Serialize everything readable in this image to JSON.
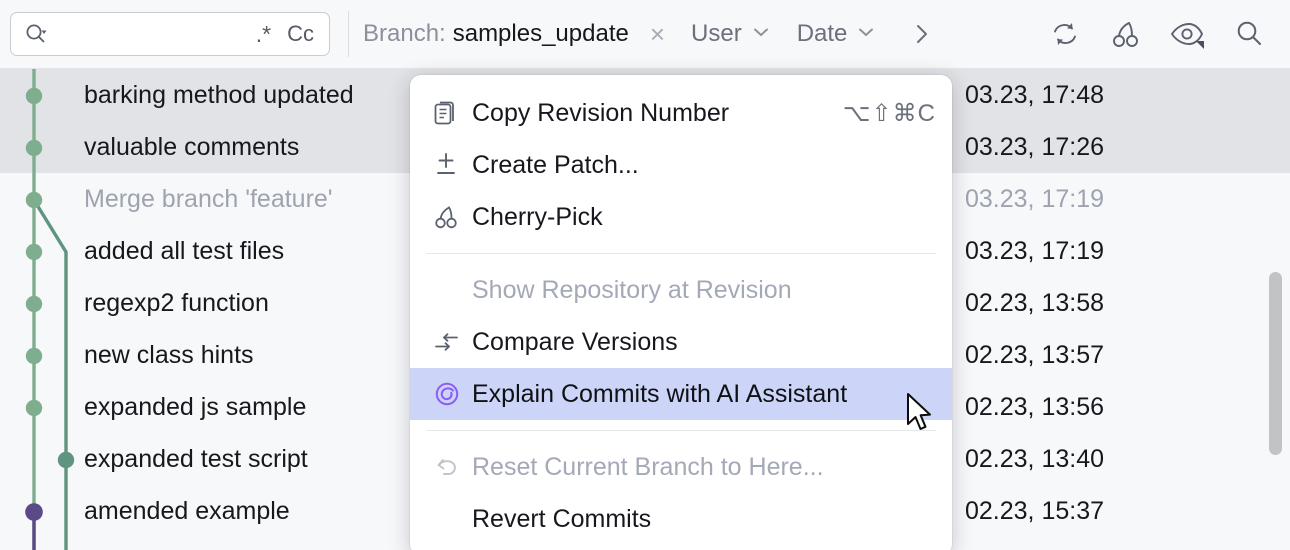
{
  "toolbar": {
    "search": {
      "value": "",
      "placeholder": "",
      "icon": "search-dropdown-icon"
    },
    "regex_toggle": ".*",
    "case_toggle": "Cc",
    "branch_filter": {
      "key": "Branch:",
      "value": "samples_update",
      "clear": "×"
    },
    "user_filter": "User",
    "date_filter": "Date",
    "more_chevron": "›",
    "actions": [
      {
        "name": "refresh-icon",
        "label": "Refresh"
      },
      {
        "name": "cherry-pick-icon",
        "label": "Cherry-Pick"
      },
      {
        "name": "eye-icon",
        "label": "Show Details"
      },
      {
        "name": "search-icon",
        "label": "Search"
      }
    ]
  },
  "log": {
    "rows": [
      {
        "subject": "barking method updated",
        "date": "03.23, 17:48",
        "selected": true,
        "muted": false
      },
      {
        "subject": "valuable comments",
        "date": "03.23, 17:26",
        "selected": true,
        "muted": false
      },
      {
        "subject": "Merge branch 'feature'",
        "date": "03.23, 17:19",
        "selected": false,
        "muted": true
      },
      {
        "subject": "added all test files",
        "date": "03.23, 17:19",
        "selected": false,
        "muted": false
      },
      {
        "subject": "regexp2 function",
        "date": "02.23, 13:58",
        "selected": false,
        "muted": false
      },
      {
        "subject": "new class hints",
        "date": "02.23, 13:57",
        "selected": false,
        "muted": false
      },
      {
        "subject": "expanded js sample",
        "date": "02.23, 13:56",
        "selected": false,
        "muted": false
      },
      {
        "subject": "expanded test script",
        "date": "02.23, 13:40",
        "selected": false,
        "muted": false
      },
      {
        "subject": "amended example",
        "date": "02.23, 15:37",
        "selected": false,
        "muted": false
      }
    ],
    "graph_colors": {
      "lane_main": "#7fae8e",
      "lane_branch": "#5f9480",
      "node_head": "#5a4a87"
    }
  },
  "context_menu": {
    "items": [
      {
        "label": "Copy Revision Number",
        "icon": "copy-icon",
        "shortcut": "⌥⇧⌘C",
        "disabled": false,
        "highlight": false,
        "sep_after": false
      },
      {
        "label": "Create Patch...",
        "icon": "patch-icon",
        "shortcut": "",
        "disabled": false,
        "highlight": false,
        "sep_after": false
      },
      {
        "label": "Cherry-Pick",
        "icon": "cherry-icon",
        "shortcut": "",
        "disabled": false,
        "highlight": false,
        "sep_after": true
      },
      {
        "label": "Show Repository at Revision",
        "icon": "none",
        "shortcut": "",
        "disabled": true,
        "highlight": false,
        "sep_after": false
      },
      {
        "label": "Compare Versions",
        "icon": "compare-icon",
        "shortcut": "",
        "disabled": false,
        "highlight": false,
        "sep_after": false
      },
      {
        "label": "Explain Commits with AI Assistant",
        "icon": "ai-assistant-icon",
        "shortcut": "",
        "disabled": false,
        "highlight": true,
        "sep_after": true
      },
      {
        "label": "Reset Current Branch to Here...",
        "icon": "undo-icon",
        "shortcut": "",
        "disabled": true,
        "highlight": false,
        "sep_after": false
      },
      {
        "label": "Revert Commits",
        "icon": "none",
        "shortcut": "",
        "disabled": false,
        "highlight": false,
        "sep_after": false
      }
    ],
    "highlight_color": "#ccd4f7",
    "ai_icon_color": "#8b5cf6"
  }
}
